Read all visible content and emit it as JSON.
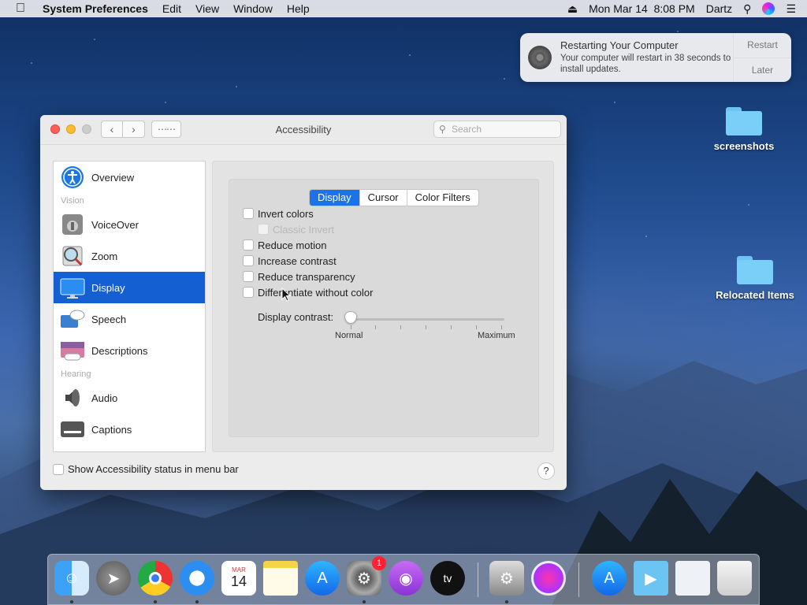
{
  "menubar": {
    "app_name": "System Preferences",
    "menus": [
      "Edit",
      "View",
      "Window",
      "Help"
    ],
    "datetime": "Mon Mar 14  8:08 PM",
    "user": "Dartz"
  },
  "notification": {
    "title": "Restarting Your Computer",
    "body": "Your computer will restart in 38 seconds to install updates.",
    "restart_label": "Restart",
    "later_label": "Later"
  },
  "desktop": {
    "icons": [
      "screenshots",
      "Relocated Items"
    ]
  },
  "window": {
    "title": "Accessibility",
    "search_placeholder": "Search"
  },
  "sidebar": {
    "overview": "Overview",
    "vision_header": "Vision",
    "voiceover": "VoiceOver",
    "zoom": "Zoom",
    "display": "Display",
    "speech": "Speech",
    "descriptions": "Descriptions",
    "hearing_header": "Hearing",
    "audio": "Audio",
    "captions": "Captions"
  },
  "tabs": [
    "Display",
    "Cursor",
    "Color Filters"
  ],
  "options": {
    "invert_colors": "Invert colors",
    "classic_invert": "Classic Invert",
    "reduce_motion": "Reduce motion",
    "increase_contrast": "Increase contrast",
    "reduce_transparency": "Reduce transparency",
    "differentiate": "Differentiate without color"
  },
  "contrast": {
    "label": "Display contrast:",
    "min_label": "Normal",
    "max_label": "Maximum",
    "value": 0
  },
  "footer": {
    "status_label": "Show Accessibility status in menu bar",
    "help": "?"
  },
  "dock": {
    "calendar_month": "MAR",
    "calendar_day": "14",
    "settings_badge": "1",
    "tv_label": "tv"
  },
  "colors": {
    "selection": "#1460d2",
    "tab_active": "#1c73e8"
  }
}
